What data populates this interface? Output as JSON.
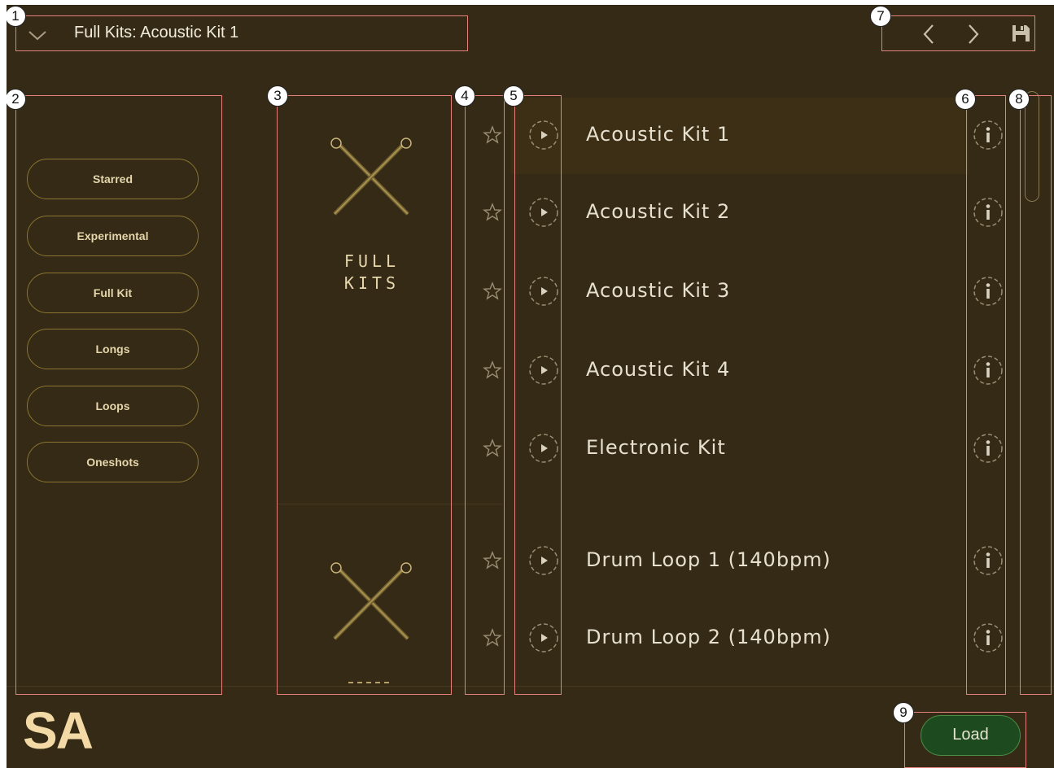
{
  "header": {
    "title": "Full Kits: Acoustic Kit 1",
    "dropdown_icon": "chevron-down-icon",
    "nav_icons": [
      "chevron-left-icon",
      "chevron-right-icon",
      "save-icon"
    ]
  },
  "sidebar": {
    "tags": [
      "Starred",
      "Experimental",
      "Full Kit",
      "Longs",
      "Loops",
      "Oneshots"
    ]
  },
  "categories": [
    {
      "label_line1": "FULL",
      "label_line2": "KITS",
      "icon": "drumsticks-icon"
    },
    {
      "label_line1": "",
      "label_line2": "",
      "icon": "drumsticks-icon"
    }
  ],
  "presets": [
    {
      "name": "Acoustic Kit 1",
      "selected": true
    },
    {
      "name": "Acoustic Kit 2",
      "selected": false
    },
    {
      "name": "Acoustic Kit 3",
      "selected": false
    },
    {
      "name": "Acoustic Kit 4",
      "selected": false
    },
    {
      "name": "Electronic Kit",
      "selected": false
    },
    {
      "name": "Drum Loop 1 (140bpm)",
      "selected": false
    },
    {
      "name": "Drum Loop 2 (140bpm)",
      "selected": false
    }
  ],
  "annotations": [
    "1",
    "2",
    "3",
    "4",
    "5",
    "6",
    "7",
    "8",
    "9"
  ],
  "footer": {
    "logo": "SA",
    "load_label": "Load"
  },
  "colors": {
    "background": "#342a15",
    "accent_gold": "#b79a4a",
    "text": "#e7e0cf",
    "load_button": "#1d4a1f",
    "annotation_box": "#e4817c"
  }
}
